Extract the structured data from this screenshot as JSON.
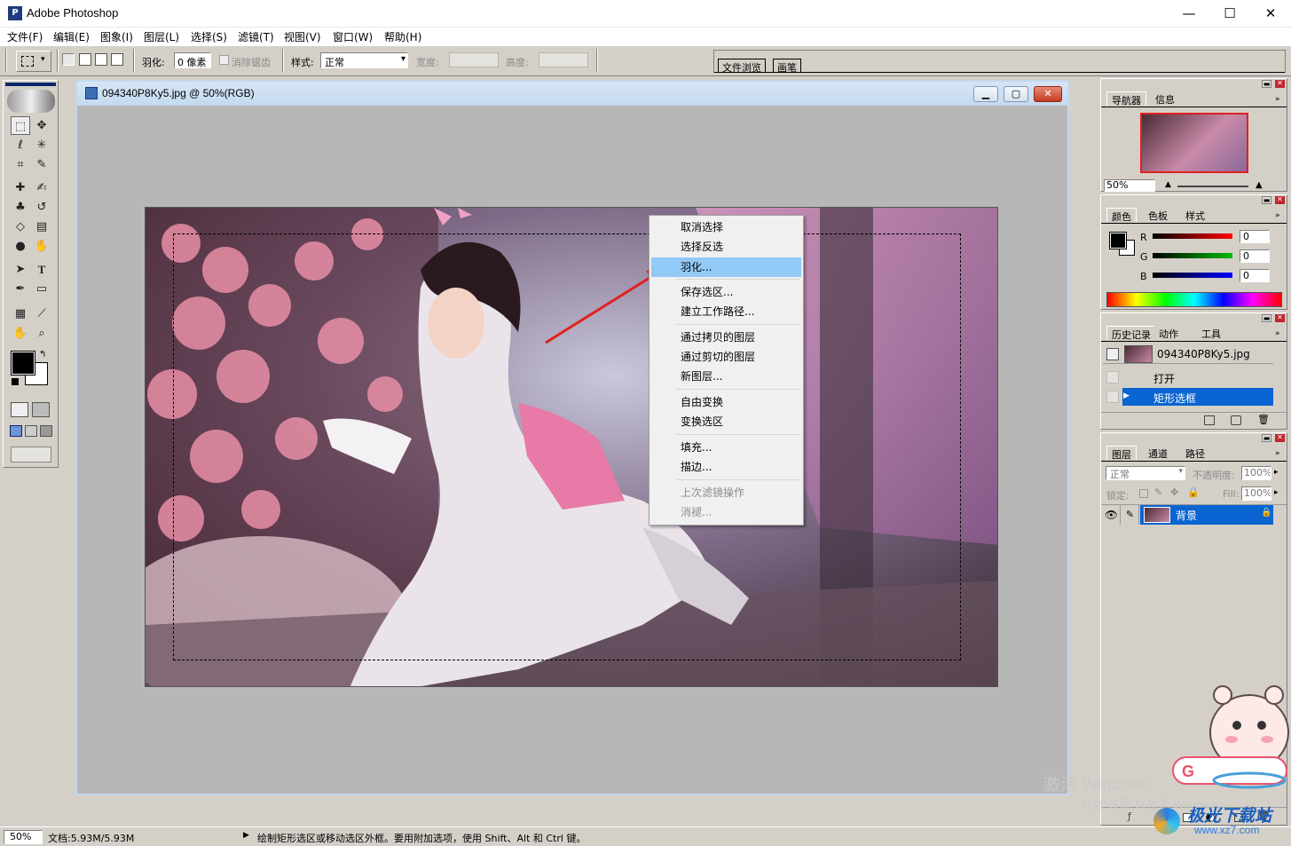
{
  "app": {
    "title": "Adobe Photoshop",
    "icon": "photoshop-app-icon"
  },
  "window_controls": {
    "minimize": "—",
    "maximize": "☐",
    "close": "✕"
  },
  "menu": [
    "文件(F)",
    "编辑(E)",
    "图象(I)",
    "图层(L)",
    "选择(S)",
    "滤镜(T)",
    "视图(V)",
    "窗口(W)",
    "帮助(H)"
  ],
  "options": {
    "feather_label": "羽化:",
    "feather_value": "0 像素",
    "antialias_label": "消除锯齿",
    "style_label": "样式:",
    "style_value": "正常",
    "width_label": "宽度:",
    "height_label": "高度:",
    "tab_file_browser": "文件浏览",
    "tab_brushes": "画笔"
  },
  "document": {
    "title": "094340P8Ky5.jpg @ 50%(RGB)",
    "photo_desc": "cosplay-photo"
  },
  "context_menu": {
    "items": [
      {
        "label": "取消选择",
        "state": "normal"
      },
      {
        "label": "选择反选",
        "state": "normal"
      },
      {
        "label": "羽化...",
        "state": "selected"
      },
      {
        "label": "保存选区...",
        "state": "normal"
      },
      {
        "label": "建立工作路径...",
        "state": "normal"
      },
      {
        "label": "通过拷贝的图层",
        "state": "normal"
      },
      {
        "label": "通过剪切的图层",
        "state": "normal"
      },
      {
        "label": "新图层...",
        "state": "normal"
      },
      {
        "label": "自由变换",
        "state": "normal"
      },
      {
        "label": "变换选区",
        "state": "normal"
      },
      {
        "label": "填充...",
        "state": "normal"
      },
      {
        "label": "描边...",
        "state": "normal"
      },
      {
        "label": "上次滤镜操作",
        "state": "disabled"
      },
      {
        "label": "消褪...",
        "state": "disabled"
      }
    ],
    "highlight_color": "#91c9f7"
  },
  "navigator": {
    "tabs": [
      "导航器",
      "信息"
    ],
    "zoom": "50%"
  },
  "color_palette": {
    "tabs": [
      "颜色",
      "色板",
      "样式"
    ],
    "channels": [
      {
        "label": "R",
        "value": "0",
        "color": "#ff0000"
      },
      {
        "label": "G",
        "value": "0",
        "color": "#00b000"
      },
      {
        "label": "B",
        "value": "0",
        "color": "#0000ff"
      }
    ]
  },
  "history": {
    "tabs": [
      "历史记录",
      "动作",
      "工具"
    ],
    "snapshot": "094340P8Ky5.jpg",
    "items": [
      {
        "label": "打开",
        "active": false
      },
      {
        "label": "矩形选框",
        "active": true
      }
    ]
  },
  "layers": {
    "tabs": [
      "图层",
      "通道",
      "路径"
    ],
    "blend_mode": "正常",
    "opacity_label": "不透明度:",
    "opacity_value": "100%",
    "lock_label": "锁定:",
    "fill_label": "Fill:",
    "fill_value": "100%",
    "layer_name": "背景",
    "selection_color": "#0a64d2"
  },
  "status": {
    "zoom": "50%",
    "doc_size": "文档:5.93M/5.93M",
    "hint": "绘制矩形选区或移动选区外框。要用附加选项，使用 Shift、Alt 和 Ctrl 键。"
  },
  "watermark": {
    "activate_line1": "激活 Windows",
    "activate_line2": "转到\"设置\"以激活 Windows。",
    "site_name": "极光下载站",
    "site_url": "www.xz7.com"
  }
}
